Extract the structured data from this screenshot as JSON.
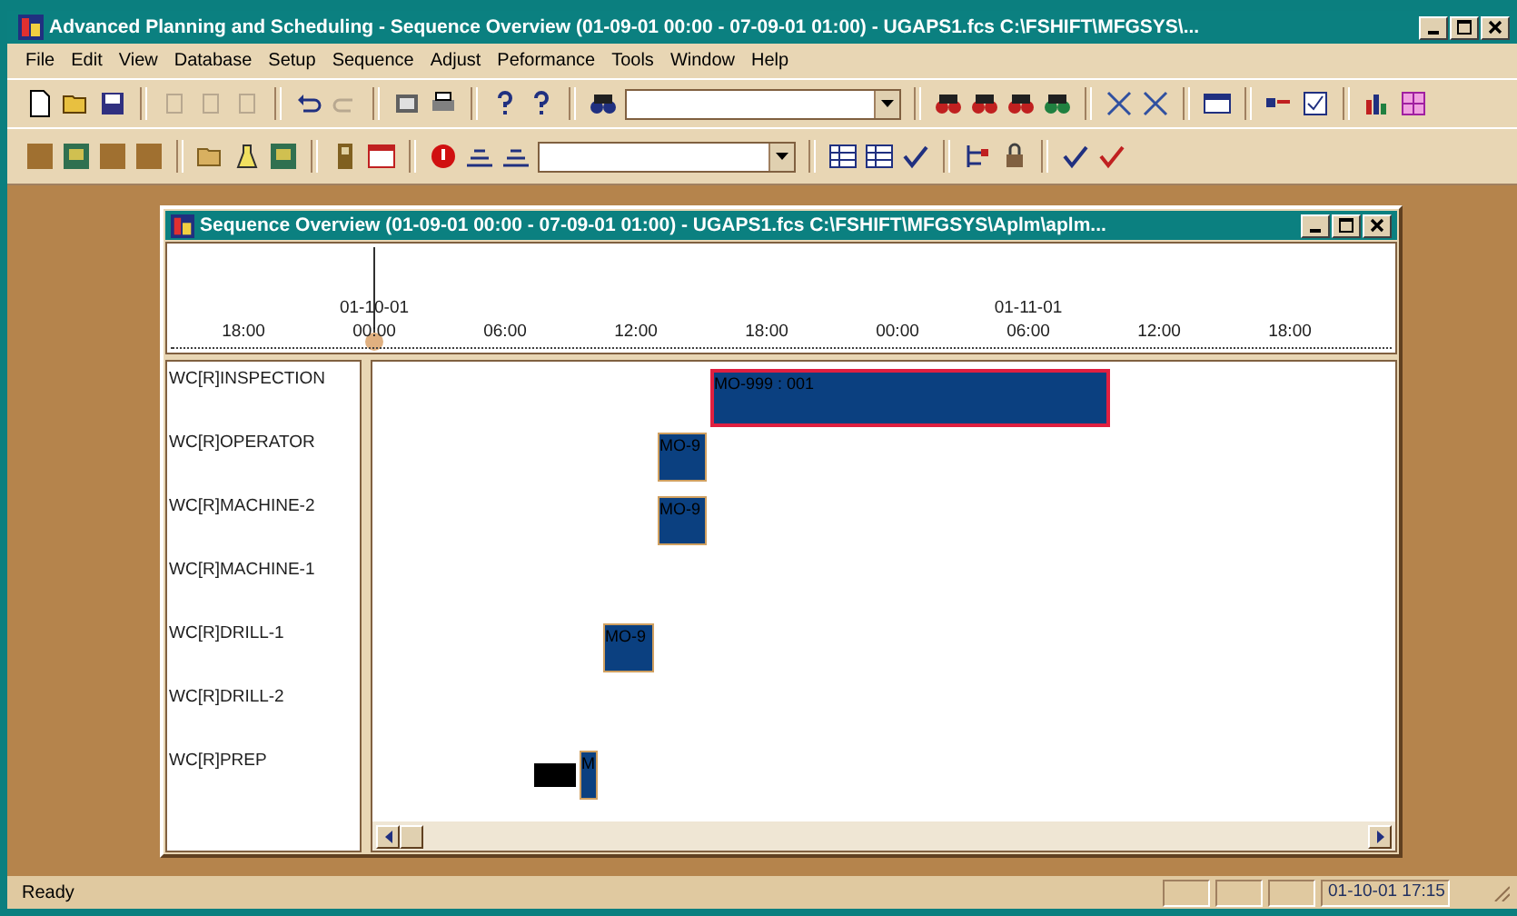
{
  "window": {
    "title": "Advanced Planning and Scheduling - Sequence Overview (01-09-01 00:00 - 07-09-01 01:00) - UGAPS1.fcs C:\\FSHIFT\\MFGSYS\\..."
  },
  "menu": [
    "File",
    "Edit",
    "View",
    "Database",
    "Setup",
    "Sequence",
    "Adjust",
    "Peformance",
    "Tools",
    "Window",
    "Help"
  ],
  "child_window": {
    "title": "Sequence Overview (01-09-01 00:00 - 07-09-01 01:00) - UGAPS1.fcs C:\\FSHIFT\\MFGSYS\\Aplm\\aplm...",
    "ticks": [
      {
        "label": "18:00"
      },
      {
        "label": "00:00",
        "date": "01-10-01"
      },
      {
        "label": "06:00"
      },
      {
        "label": "12:00"
      },
      {
        "label": "18:00"
      },
      {
        "label": "00:00"
      },
      {
        "label": "06:00",
        "date": "01-11-01"
      },
      {
        "label": "12:00"
      },
      {
        "label": "18:00"
      }
    ],
    "rows": [
      {
        "resource": "WC[R]INSPECTION",
        "bars": [
          {
            "kind": "order",
            "label": "MO-999 : 001",
            "selected": true
          }
        ]
      },
      {
        "resource": "WC[R]OPERATOR",
        "bars": [
          {
            "kind": "order",
            "label": "MO-9",
            "selected": false
          }
        ]
      },
      {
        "resource": "WC[R]MACHINE-2",
        "bars": [
          {
            "kind": "order",
            "label": "MO-9",
            "selected": false
          }
        ]
      },
      {
        "resource": "WC[R]MACHINE-1",
        "bars": []
      },
      {
        "resource": "WC[R]DRILL-1",
        "bars": [
          {
            "kind": "order",
            "label": "MO-9",
            "selected": false
          }
        ]
      },
      {
        "resource": "WC[R]DRILL-2",
        "bars": []
      },
      {
        "resource": "WC[R]PREP",
        "bars": [
          {
            "kind": "setup"
          },
          {
            "kind": "order",
            "label": "M",
            "selected": false
          }
        ]
      }
    ]
  },
  "status_bar": {
    "message": "Ready",
    "datetime": "01-10-01 17:15"
  }
}
